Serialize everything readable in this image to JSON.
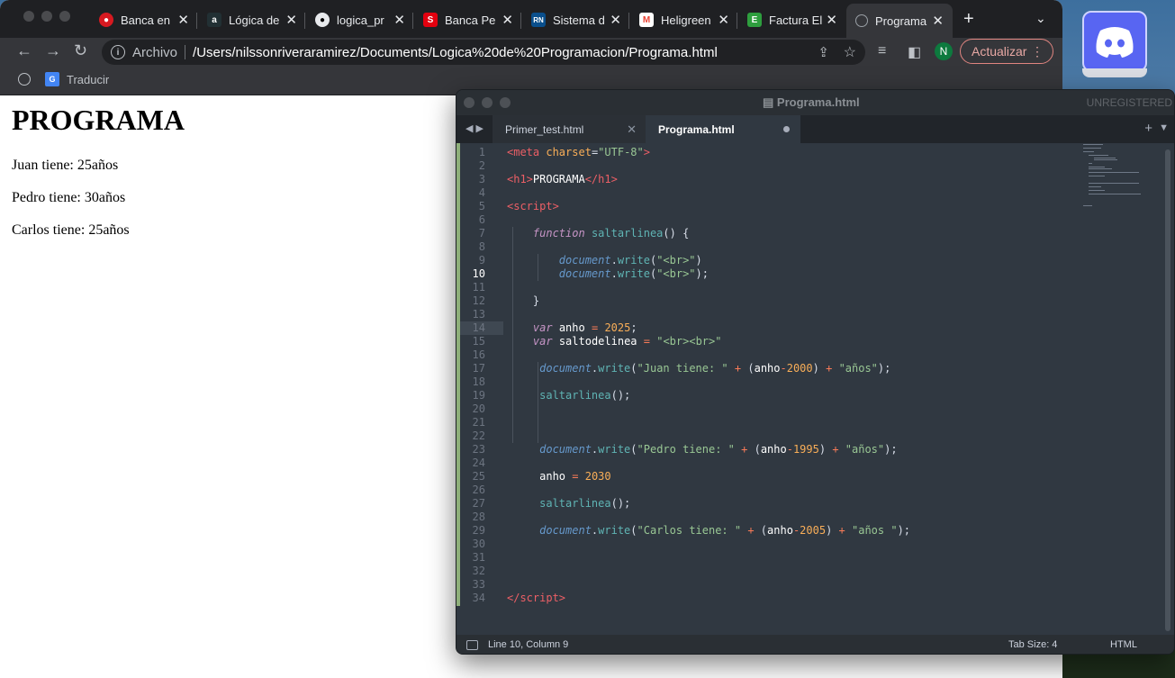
{
  "browser": {
    "tabs": [
      {
        "title": "Banca en",
        "favicon_color": "#d71920",
        "favicon_glyph": "●"
      },
      {
        "title": "Lógica de",
        "favicon_color": "#223034",
        "favicon_glyph": "a"
      },
      {
        "title": "logica_pr",
        "favicon_color": "#000000",
        "favicon_glyph": "◉"
      },
      {
        "title": "Banca Pe",
        "favicon_color": "#e3000f",
        "favicon_glyph": "S"
      },
      {
        "title": "Sistema d",
        "favicon_color": "#0a4f8c",
        "favicon_glyph": "RN"
      },
      {
        "title": "Heligreen",
        "favicon_color": "#ffffff",
        "favicon_glyph": "M"
      },
      {
        "title": "Factura El",
        "favicon_color": "#2e9e3e",
        "favicon_glyph": "E"
      },
      {
        "title": "Programa",
        "favicon_color": "#9aa0a6",
        "favicon_glyph": "◍"
      }
    ],
    "new_tab": "+",
    "address": {
      "scheme": "Archivo",
      "url": "/Users/nilssonriveraramirez/Documents/Logica%20de%20Programacion/Programa.html"
    },
    "profile_initial": "N",
    "update_label": "Actualizar",
    "bookmarks": [
      {
        "label": "Traducir",
        "icon": "google-translate-icon"
      }
    ]
  },
  "page": {
    "heading": "PROGRAMA",
    "lines": [
      "Juan tiene: 25años",
      "Pedro tiene: 30años",
      "Carlos tiene: 25años"
    ]
  },
  "editor": {
    "window_title": "Programa.html",
    "registration": "UNREGISTERED",
    "tabs": [
      {
        "label": "Primer_test.html",
        "active": false
      },
      {
        "label": "Programa.html",
        "active": true,
        "dirty": true
      }
    ],
    "status": {
      "position": "Line 10, Column 9",
      "tab_size": "Tab Size: 4",
      "syntax": "HTML"
    },
    "line_numbers": [
      "1",
      "2",
      "3",
      "4",
      "5",
      "6",
      "7",
      "8",
      "9",
      "10",
      "11",
      "12",
      "13",
      "14",
      "15",
      "16",
      "17",
      "18",
      "19",
      "20",
      "21",
      "22",
      "23",
      "24",
      "25",
      "26",
      "27",
      "28",
      "29",
      "30",
      "31",
      "32",
      "33",
      "34"
    ]
  },
  "colors": {
    "chrome_bg": "#35363a",
    "sublime_bg": "#303841",
    "discord": "#5865f2"
  }
}
